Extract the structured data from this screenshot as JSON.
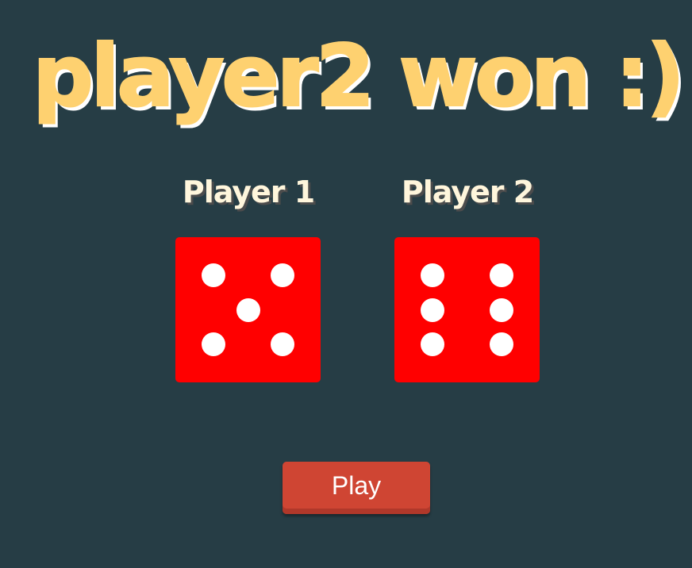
{
  "game": {
    "result_text": "player2 won :)",
    "players": [
      {
        "label": "Player 1",
        "die_value": 5
      },
      {
        "label": "Player 2",
        "die_value": 6
      }
    ],
    "play_button_label": "Play"
  },
  "colors": {
    "background": "#263d45",
    "title": "#fed170",
    "title_shadow": "#ffffff",
    "player_label": "#fff6dc",
    "die": "#ff0000",
    "pip": "#ffffff",
    "play_button": "#cf4533"
  }
}
